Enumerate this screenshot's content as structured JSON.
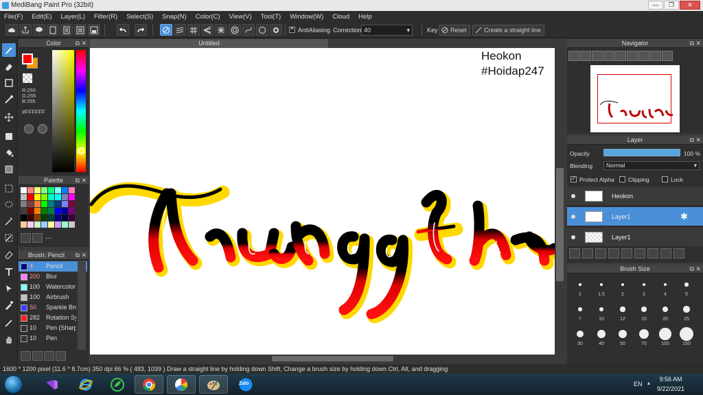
{
  "window": {
    "title": "MediBang Paint Pro (32bit)"
  },
  "menu": [
    "File(F)",
    "Edit(E)",
    "Layer(L)",
    "Filter(R)",
    "Select(S)",
    "Snap(N)",
    "Color(C)",
    "View(V)",
    "Tool(T)",
    "Window(W)",
    "Cloud",
    "Help"
  ],
  "toolbar": {
    "antialias_label": "AntiAliasing",
    "correction_label": "Correction",
    "correction_value": "40",
    "key_label": "Key",
    "reset_label": "Reset",
    "straight_line_label": "Create a straight line"
  },
  "color_panel": {
    "title": "Color",
    "fg_color": "#ff0000",
    "bg_color": "#ff9900",
    "r_text": "R:255",
    "g_text": "G:255",
    "b_text": "B:255",
    "hex_text": "#FFFFFF"
  },
  "palette_panel": {
    "title": "Palette",
    "footer_text": "---",
    "colors": [
      "#ffffff",
      "#ff8080",
      "#ffff80",
      "#80ff80",
      "#00ff80",
      "#80ffff",
      "#0080ff",
      "#ff80c0",
      "#c0c0c0",
      "#ff0000",
      "#ffff00",
      "#80ff00",
      "#00ffc0",
      "#00ffff",
      "#8080c0",
      "#ff00ff",
      "#808080",
      "#804040",
      "#ff8040",
      "#00ff00",
      "#008080",
      "#004080",
      "#8080ff",
      "#800040",
      "#404040",
      "#800000",
      "#ff8000",
      "#008000",
      "#008040",
      "#0000ff",
      "#0000a0",
      "#800080",
      "#000000",
      "#400000",
      "#804000",
      "#004000",
      "#004040",
      "#000080",
      "#000040",
      "#400040",
      "#ffcc99",
      "#ffccff",
      "#ccffcc",
      "#99ccff",
      "#ffff99",
      "#cc99ff",
      "#99ffcc",
      "#cccccc"
    ]
  },
  "brush_panel": {
    "title": "Brush: Pencil",
    "brushes": [
      {
        "size": "4",
        "name": "Pencil",
        "color": "#000080",
        "active": true
      },
      {
        "size": "200",
        "name": "Blur",
        "color": "#ff80ff",
        "active": false
      },
      {
        "size": "100",
        "name": "Watercolor",
        "color": "#80ffff",
        "active": false
      },
      {
        "size": "100",
        "name": "Airbrush",
        "color": "#c0c0c0",
        "active": false
      },
      {
        "size": "50",
        "name": "Sparkle Brush",
        "color": "#4040ff",
        "active": false
      },
      {
        "size": "282",
        "name": "Rotation Sym",
        "color": "#ff2020",
        "active": false
      },
      {
        "size": "10",
        "name": "Pen (Sharp)",
        "color": "#333333",
        "active": false
      },
      {
        "size": "10",
        "name": "Pen",
        "color": "#333333",
        "active": false
      }
    ]
  },
  "canvas": {
    "tab_title": "Untitled",
    "watermark_name": "Heokon",
    "watermark_tag": "#Hoidap247"
  },
  "navigator": {
    "title": "Navigator"
  },
  "layer_panel": {
    "title": "Layer",
    "opacity_label": "Opacity",
    "opacity_value": "100 %",
    "opacity_fraction": 1.0,
    "blending_label": "Blending",
    "blending_value": "Normal",
    "protect_alpha_label": "Protect Alpha",
    "clipping_label": "Clipping",
    "lock_label": "Lock",
    "layers": [
      {
        "name": "Heokon",
        "active": false
      },
      {
        "name": "Layer1",
        "active": true
      },
      {
        "name": "Layer1",
        "active": false
      }
    ]
  },
  "brush_size_panel": {
    "title": "Brush Size",
    "sizes": [
      "1",
      "1.5",
      "2",
      "3",
      "4",
      "5",
      "7",
      "10",
      "12",
      "15",
      "20",
      "25",
      "30",
      "40",
      "50",
      "70",
      "100",
      "150"
    ]
  },
  "status": {
    "text": "1600 * 1200 pixel  (11.6 * 8.7cm)  350 dpi  66 %   ( 483, 1039 )  Draw a straight line by holding down Shift, Change a brush size by holding down Ctrl, Alt, and dragging"
  },
  "taskbar": {
    "apps": [
      "visual-studio",
      "internet-explorer",
      "green-app",
      "chrome",
      "picasa",
      "medibang-paint",
      "zalo"
    ],
    "zalo_label": "Zalo",
    "language": "EN",
    "time": "9:56 AM",
    "date": "9/22/2021"
  }
}
